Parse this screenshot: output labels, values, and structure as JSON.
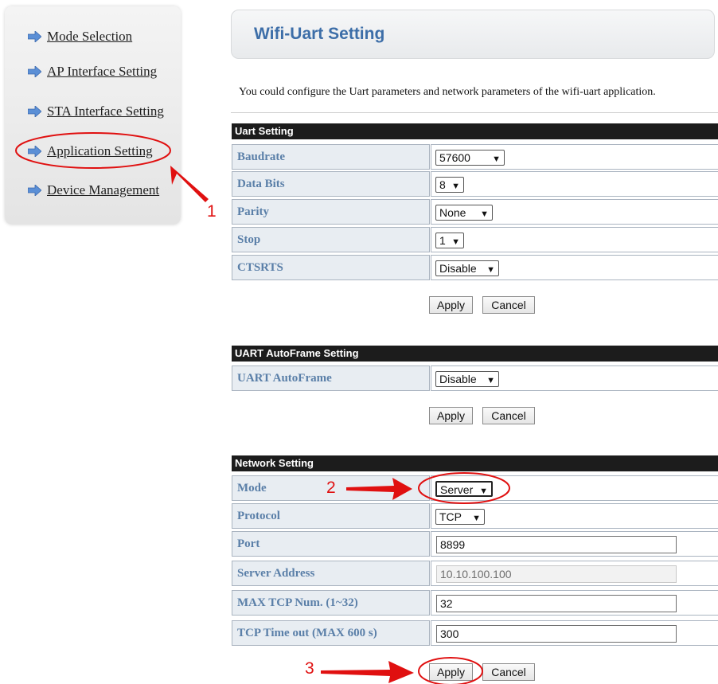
{
  "sidebar": {
    "items": [
      {
        "label": "Mode Selection"
      },
      {
        "label": "AP Interface Setting"
      },
      {
        "label": "STA Interface Setting"
      },
      {
        "label": "Application Setting"
      },
      {
        "label": "Device Management"
      }
    ]
  },
  "page": {
    "title": "Wifi-Uart Setting",
    "description": "You could configure the Uart parameters and network parameters of the wifi-uart application."
  },
  "uart": {
    "header": "Uart Setting",
    "rows": [
      {
        "label": "Baudrate",
        "value": "57600"
      },
      {
        "label": "Data Bits",
        "value": "8"
      },
      {
        "label": "Parity",
        "value": "None"
      },
      {
        "label": "Stop",
        "value": "1"
      },
      {
        "label": "CTSRTS",
        "value": "Disable"
      }
    ],
    "apply": "Apply",
    "cancel": "Cancel"
  },
  "autoframe": {
    "header": "UART AutoFrame Setting",
    "rows": [
      {
        "label": "UART AutoFrame",
        "value": "Disable"
      }
    ],
    "apply": "Apply",
    "cancel": "Cancel"
  },
  "network": {
    "header": "Network Setting",
    "mode": {
      "label": "Mode",
      "value": "Server"
    },
    "protocol": {
      "label": "Protocol",
      "value": "TCP"
    },
    "port": {
      "label": "Port",
      "value": "8899"
    },
    "server_address": {
      "label": "Server Address",
      "value": "10.10.100.100"
    },
    "max_tcp": {
      "label": "MAX TCP Num. (1~32)",
      "value": "32"
    },
    "timeout": {
      "label": "TCP Time out (MAX 600 s)",
      "value": "300"
    },
    "apply": "Apply",
    "cancel": "Cancel"
  },
  "annotations": {
    "n1": "1",
    "n2": "2",
    "n3": "3",
    "color": "#e01010"
  },
  "icons": {
    "nav_arrow": "right-arrow-icon",
    "select_chevron": "chevron-down-icon"
  }
}
